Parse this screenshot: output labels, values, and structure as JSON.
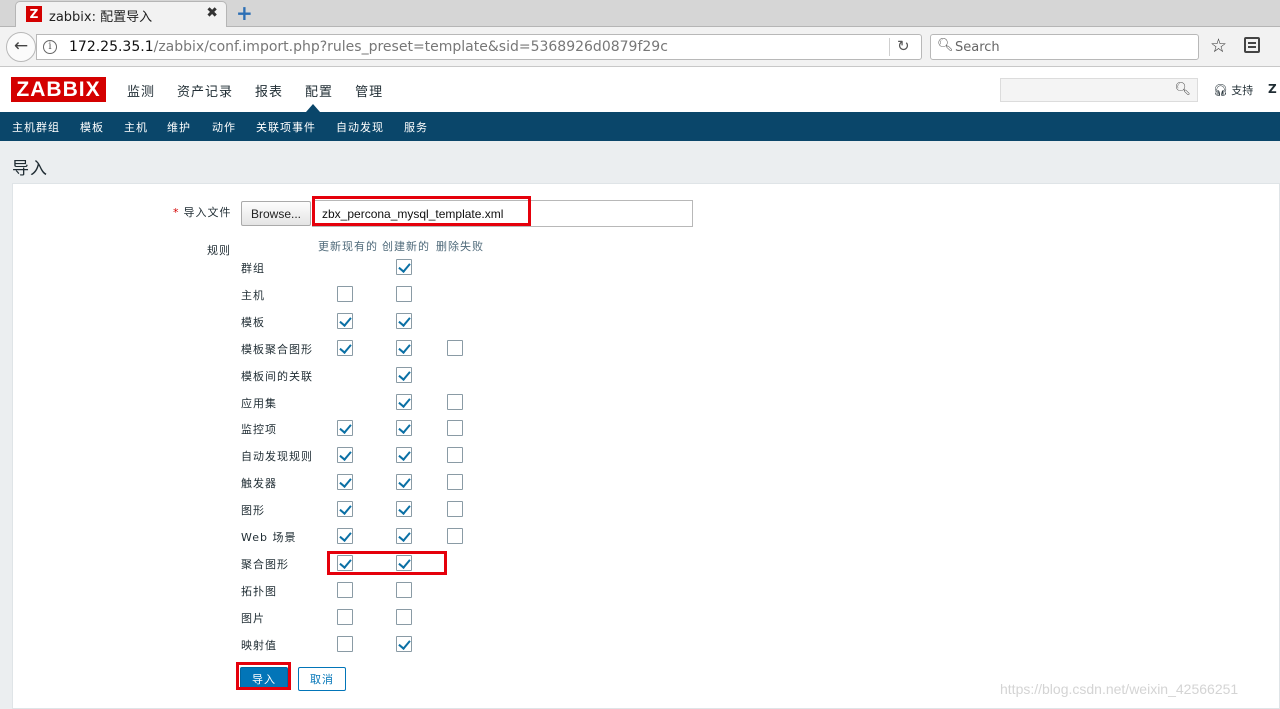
{
  "browser": {
    "tab_title": "zabbix: 配置导入",
    "tab_favicon": "Z",
    "tab_close": "✖",
    "new_tab": "+",
    "url_host": "172.25.35.1",
    "url_rest": "/zabbix/conf.import.php?rules_preset=template&sid=5368926d0879f29c",
    "search_placeholder": "Search",
    "icons": [
      "back-arrow-icon",
      "info-icon",
      "reload-icon",
      "search-icon",
      "bookmark-star-icon",
      "reader-icon"
    ]
  },
  "zabbix": {
    "logo": "ZABBIX",
    "top_menu": [
      "监测",
      "资产记录",
      "报表",
      "配置",
      "管理"
    ],
    "active_top": "配置",
    "support": "支持",
    "share": "Z",
    "sub_menu": [
      "主机群组",
      "模板",
      "主机",
      "维护",
      "动作",
      "关联项事件",
      "自动发现",
      "服务"
    ],
    "brand_color": "#d40000",
    "nav_color": "#0a466a"
  },
  "page": {
    "title": "导入",
    "file_label": "导入文件",
    "browse_label": "Browse...",
    "file_name": "zbx_percona_mysql_template.xml",
    "rules_label": "规则",
    "columns": [
      "更新现有的",
      "创建新的",
      "删除失败"
    ],
    "rules": [
      {
        "label": "群组",
        "update": null,
        "create": true,
        "delete": null
      },
      {
        "label": "主机",
        "update": false,
        "create": false,
        "delete": null
      },
      {
        "label": "模板",
        "update": true,
        "create": true,
        "delete": null
      },
      {
        "label": "模板聚合图形",
        "update": true,
        "create": true,
        "delete": false
      },
      {
        "label": "模板间的关联",
        "update": null,
        "create": true,
        "delete": null
      },
      {
        "label": "应用集",
        "update": null,
        "create": true,
        "delete": false
      },
      {
        "label": "监控项",
        "update": true,
        "create": true,
        "delete": false
      },
      {
        "label": "自动发现规则",
        "update": true,
        "create": true,
        "delete": false
      },
      {
        "label": "触发器",
        "update": true,
        "create": true,
        "delete": false
      },
      {
        "label": "图形",
        "update": true,
        "create": true,
        "delete": false
      },
      {
        "label": "Web 场景",
        "update": true,
        "create": true,
        "delete": false
      },
      {
        "label": "聚合图形",
        "update": true,
        "create": true,
        "delete": null
      },
      {
        "label": "拓扑图",
        "update": false,
        "create": false,
        "delete": null
      },
      {
        "label": "图片",
        "update": false,
        "create": false,
        "delete": null
      },
      {
        "label": "映射值",
        "update": false,
        "create": true,
        "delete": null
      }
    ],
    "import_button": "导入",
    "cancel_button": "取消",
    "accent_color": "#0275b8",
    "highlight_color": "#e5000b"
  },
  "watermark": "https://blog.csdn.net/weixin_42566251"
}
